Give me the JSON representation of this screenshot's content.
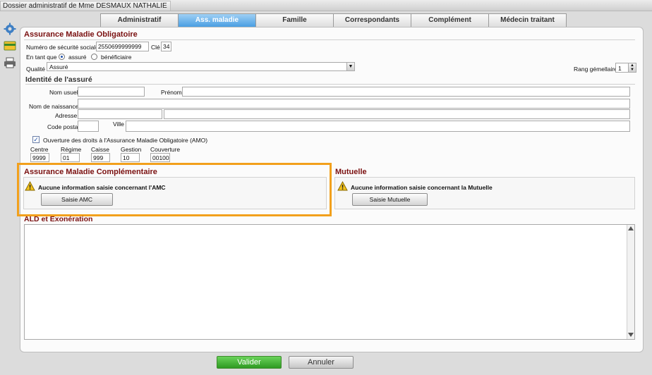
{
  "window": {
    "title": "Dossier administratif de Mme  DESMAUX NATHALIE"
  },
  "tabs": [
    {
      "label": "Administratif"
    },
    {
      "label": "Ass. maladie"
    },
    {
      "label": "Famille"
    },
    {
      "label": "Correspondants"
    },
    {
      "label": "Complément"
    },
    {
      "label": "Médecin traitant"
    }
  ],
  "amo": {
    "title": "Assurance Maladie Obligatoire",
    "secu_label": "Numéro de sécurité sociale",
    "secu_value": "2550699999999",
    "cle_label": "Clé",
    "cle_value": "34",
    "en_tant_que_label": "En tant que",
    "assure_label": "assuré",
    "beneficiaire_label": "bénéficiaire",
    "qualite_label": "Qualité",
    "qualite_value": "Assuré",
    "rang_label": "Rang gémellaire",
    "rang_value": "1"
  },
  "identite": {
    "title": "Identité de l'assuré",
    "nom_usuel": "Nom usuel",
    "prenom": "Prénom",
    "nom_naissance": "Nom de naissance",
    "adresse": "Adresse",
    "code_postal": "Code postal",
    "ville": "Ville"
  },
  "droits": {
    "checkbox_label": "Ouverture des droits à l'Assurance Maladie Obligatoire (AMO)",
    "cols": [
      {
        "label": "Centre",
        "value": "9999"
      },
      {
        "label": "Régime",
        "value": "01"
      },
      {
        "label": "Caisse",
        "value": "999"
      },
      {
        "label": "Gestion",
        "value": "10"
      },
      {
        "label": "Couverture",
        "value": "00100"
      }
    ]
  },
  "amc": {
    "title": "Assurance Maladie Complémentaire",
    "warning": "Aucune information saisie concernant l'AMC",
    "button": "Saisie AMC"
  },
  "mutuelle": {
    "title": "Mutuelle",
    "warning": "Aucune information saisie concernant la Mutuelle",
    "button": "Saisie Mutuelle"
  },
  "ald": {
    "title": "ALD et Exonération"
  },
  "footer": {
    "valider": "Valider",
    "annuler": "Annuler"
  },
  "colors": {
    "section_title": "#7a1010",
    "active_tab": "#4a9ee2",
    "highlight": "#f2a01c",
    "valider": "#2e9a22"
  }
}
